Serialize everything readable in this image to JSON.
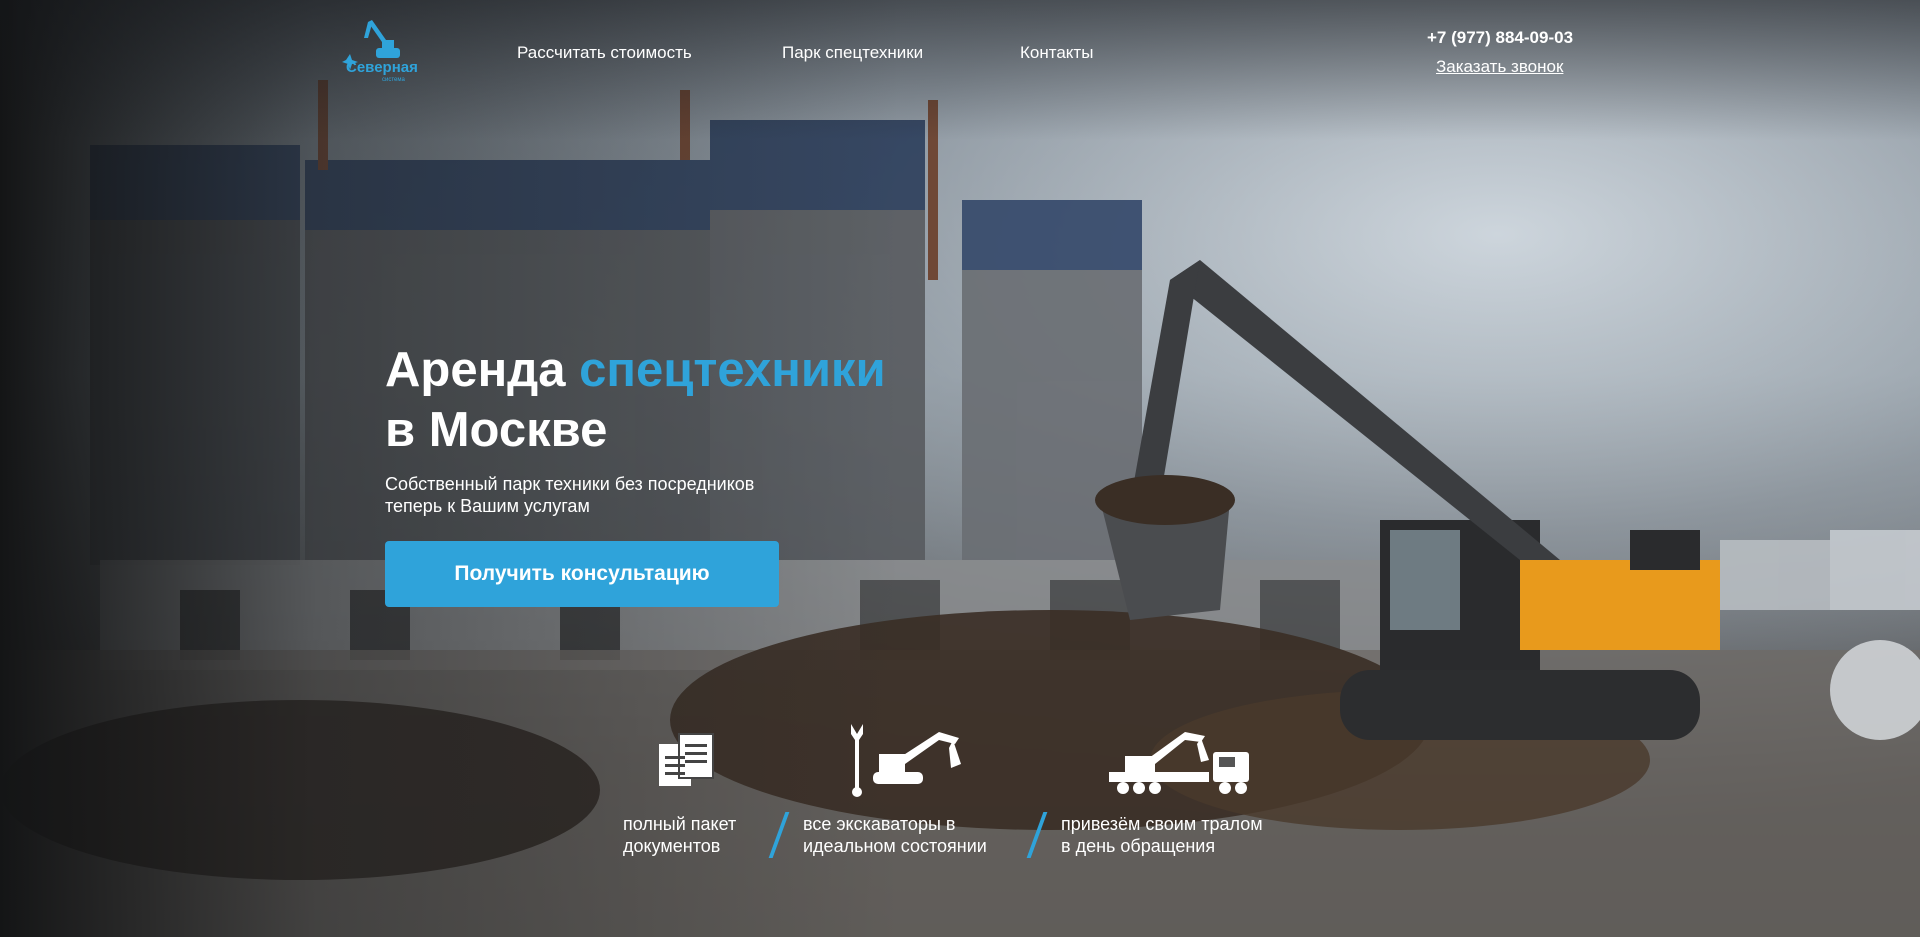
{
  "header": {
    "logo_text": "Северная",
    "logo_subtext": "система",
    "nav": [
      {
        "label": "Рассчитать стоимость"
      },
      {
        "label": "Парк спецтехники"
      },
      {
        "label": "Контакты"
      }
    ],
    "phone": "+7 (977) 884-09-03",
    "callback_label": "Заказать звонок"
  },
  "hero": {
    "title_part1": "Аренда ",
    "title_accent": "спецтехники",
    "title_line2": "в Москве",
    "subtitle_line1": "Собственный парк техники без посредников",
    "subtitle_line2": "теперь к Вашим услугам",
    "cta_label": "Получить консультацию"
  },
  "features": [
    {
      "icon": "documents-icon",
      "line1": "полный пакет",
      "line2": "документов"
    },
    {
      "icon": "wrench-excavator-icon",
      "line1": "все экскаваторы в",
      "line2": "идеальном состоянии"
    },
    {
      "icon": "truck-trailer-icon",
      "line1": "привезём своим тралом",
      "line2": "в день обращения"
    }
  ],
  "colors": {
    "accent": "#2fa3da",
    "text": "#ffffff",
    "excavator_body": "#e89a1c"
  }
}
